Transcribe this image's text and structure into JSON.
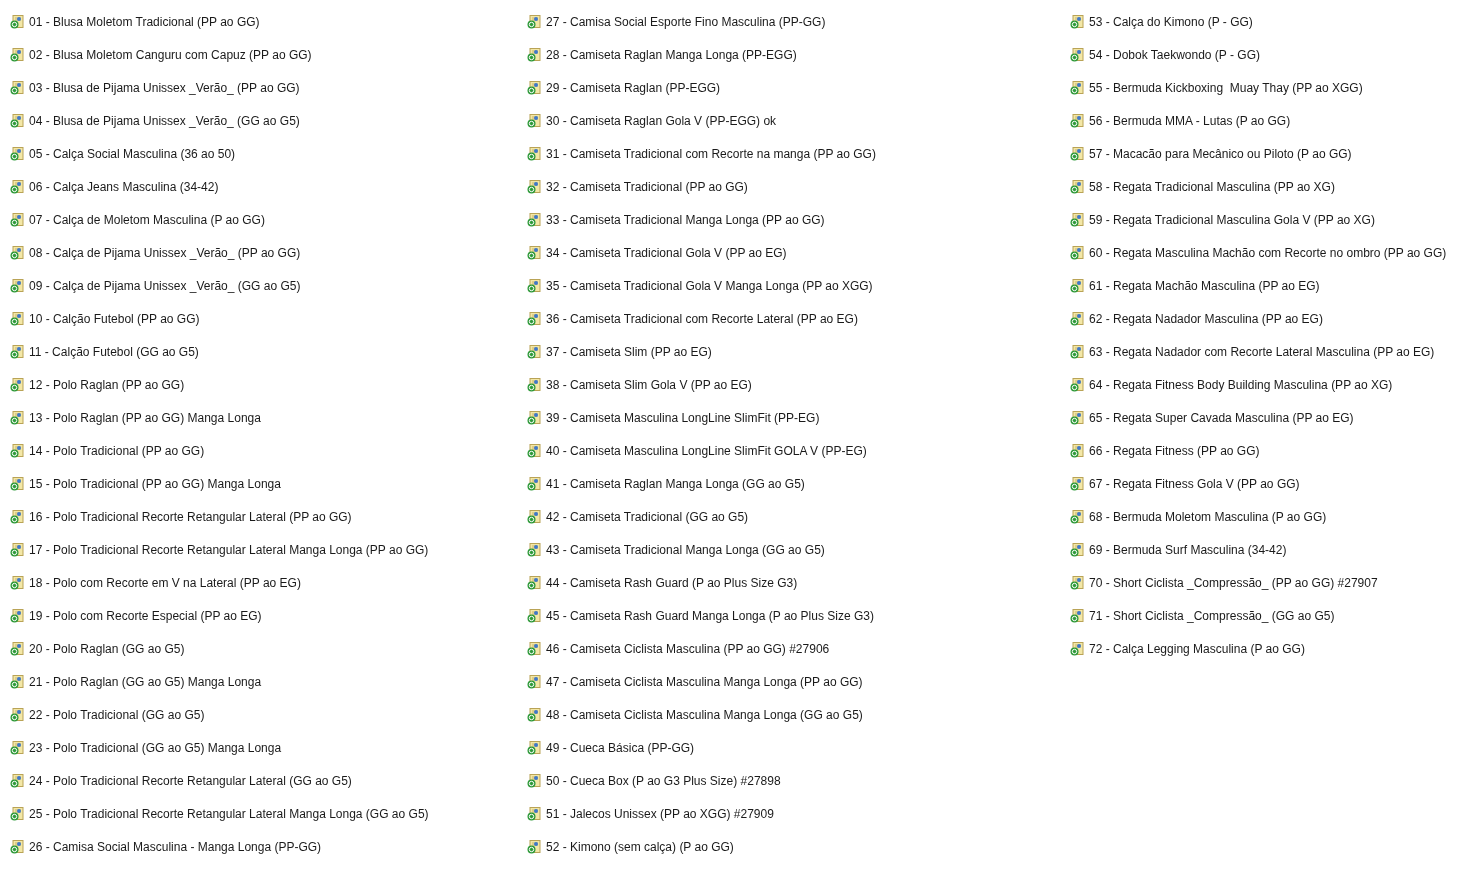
{
  "files": [
    "01 - Blusa Moletom Tradicional (PP ao GG)",
    "02 - Blusa Moletom Canguru com Capuz (PP ao GG)",
    "03 - Blusa de Pijama Unissex _Verão_ (PP ao GG)",
    "04 - Blusa de Pijama Unissex _Verão_ (GG ao G5)",
    "05 - Calça Social Masculina (36 ao 50)",
    "06 - Calça Jeans Masculina (34-42)",
    "07 - Calça de Moletom Masculina (P ao GG)",
    "08 - Calça de Pijama Unissex _Verão_ (PP ao GG)",
    "09 - Calça de Pijama Unissex _Verão_ (GG ao G5)",
    "10 - Calção Futebol (PP ao GG)",
    "11 - Calção Futebol (GG ao G5)",
    "12 - Polo Raglan (PP ao GG)",
    "13 - Polo Raglan (PP ao GG) Manga Longa",
    "14 - Polo Tradicional (PP ao GG)",
    "15 - Polo Tradicional (PP ao GG) Manga Longa",
    "16 - Polo Tradicional Recorte Retangular Lateral (PP ao GG)",
    "17 - Polo Tradicional Recorte Retangular Lateral Manga Longa (PP ao GG)",
    "18 - Polo com Recorte em V na Lateral (PP ao EG)",
    "19 - Polo com Recorte Especial (PP ao EG)",
    "20 - Polo Raglan (GG ao G5)",
    "21 - Polo Raglan (GG ao G5) Manga Longa",
    "22 - Polo Tradicional (GG ao G5)",
    "23 - Polo Tradicional (GG ao G5) Manga Longa",
    "24 - Polo Tradicional Recorte Retangular Lateral (GG ao G5)",
    "25 - Polo Tradicional Recorte Retangular Lateral Manga Longa (GG ao G5)",
    "26 - Camisa Social Masculina - Manga Longa (PP-GG)",
    "27 - Camisa Social Esporte Fino Masculina (PP-GG)",
    "28 - Camiseta Raglan Manga Longa (PP-EGG)",
    "29 - Camiseta Raglan (PP-EGG)",
    "30 - Camiseta Raglan Gola V (PP-EGG) ok",
    "31 - Camiseta Tradicional com Recorte na manga (PP ao GG)",
    "32 - Camiseta Tradicional (PP ao GG)",
    "33 - Camiseta Tradicional Manga Longa (PP ao GG)",
    "34 - Camiseta Tradicional Gola V (PP ao EG)",
    "35 - Camiseta Tradicional Gola V Manga Longa (PP ao XGG)",
    "36 - Camiseta Tradicional com Recorte Lateral (PP ao EG)",
    "37 - Camiseta Slim (PP ao EG)",
    "38 - Camiseta Slim Gola V (PP ao EG)",
    "39 - Camiseta Masculina LongLine SlimFit (PP-EG)",
    "40 - Camiseta Masculina LongLine SlimFit GOLA V (PP-EG)",
    "41 - Camiseta Raglan Manga Longa (GG ao G5)",
    "42 - Camiseta Tradicional (GG ao G5)",
    "43 - Camiseta Tradicional Manga Longa (GG ao G5)",
    "44 - Camiseta Rash Guard (P ao Plus Size G3)",
    "45 - Camiseta Rash Guard Manga Longa (P ao Plus Size G3)",
    "46 - Camiseta Ciclista Masculina (PP ao GG) #27906",
    "47 - Camiseta Ciclista Masculina Manga Longa (PP ao GG)",
    "48 - Camiseta Ciclista Masculina Manga Longa (GG ao G5)",
    "49 - Cueca Básica (PP-GG)",
    "50 - Cueca Box (P ao G3 Plus Size) #27898",
    "51 - Jalecos Unissex (PP ao XGG) #27909",
    "52 - Kimono (sem calça) (P ao GG)",
    "53 - Calça do Kimono (P - GG)",
    "54 - Dobok Taekwondo (P - GG)",
    "55 - Bermuda Kickboxing  Muay Thay (PP ao XGG)",
    "56 - Bermuda MMA - Lutas (P ao GG)",
    "57 - Macacão para Mecânico ou Piloto (P ao GG)",
    "58 - Regata Tradicional Masculina (PP ao XG)",
    "59 - Regata Tradicional Masculina Gola V (PP ao XG)",
    "60 - Regata Masculina Machão com Recorte no ombro (PP ao GG)",
    "61 - Regata Machão Masculina (PP ao EG)",
    "62 - Regata Nadador Masculina (PP ao EG)",
    "63 - Regata Nadador com Recorte Lateral Masculina (PP ao EG)",
    "64 - Regata Fitness Body Building Masculina (PP ao XG)",
    "65 - Regata Super Cavada Masculina (PP ao EG)",
    "66 - Regata Fitness (PP ao GG)",
    "67 - Regata Fitness Gola V (PP ao GG)",
    "68 - Bermuda Moletom Masculina (P ao GG)",
    "69 - Bermuda Surf Masculina (34-42)",
    "70 - Short Ciclista _Compressão_ (PP ao GG) #27907",
    "71 - Short Ciclista _Compressão_ (GG ao G5)",
    "72 - Calça Legging Masculina (P ao GG)"
  ]
}
